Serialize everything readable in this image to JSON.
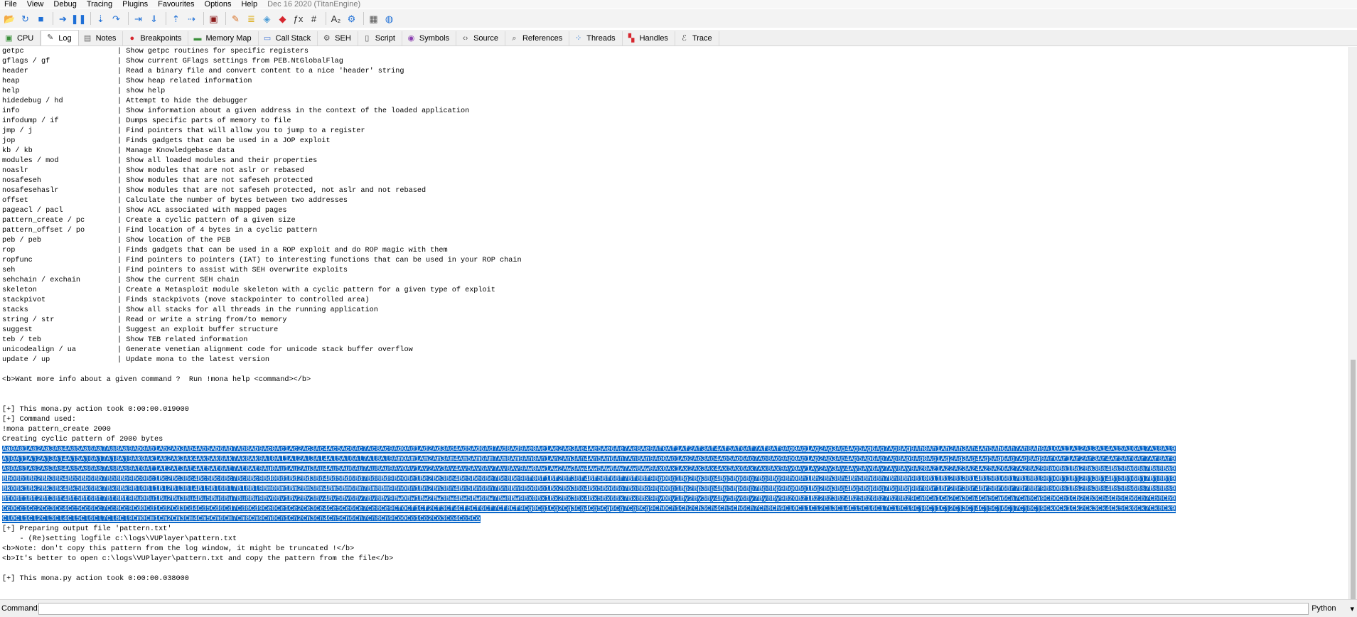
{
  "menubar": {
    "items": [
      "File",
      "View",
      "Debug",
      "Tracing",
      "Plugins",
      "Favourites",
      "Options",
      "Help"
    ],
    "build_info": "Dec 16 2020 (TitanEngine)"
  },
  "toolbar": {
    "buttons": [
      {
        "name": "open-icon",
        "glyph": "📂",
        "color": "#d9a400"
      },
      {
        "name": "restart-icon",
        "glyph": "↻",
        "color": "#1e6fd6"
      },
      {
        "name": "close-icon",
        "glyph": "■",
        "color": "#1e6fd6"
      },
      {
        "sep": true
      },
      {
        "name": "run-icon",
        "glyph": "➔",
        "color": "#1e6fd6"
      },
      {
        "name": "pause-icon",
        "glyph": "❚❚",
        "color": "#1e6fd6"
      },
      {
        "sep": true
      },
      {
        "name": "step-into-icon",
        "glyph": "⇣",
        "color": "#1e6fd6"
      },
      {
        "name": "step-over-icon",
        "glyph": "↷",
        "color": "#1e6fd6"
      },
      {
        "sep": true
      },
      {
        "name": "trace-into-icon",
        "glyph": "⇥",
        "color": "#1e6fd6"
      },
      {
        "name": "trace-over-icon",
        "glyph": "⇓",
        "color": "#1e6fd6"
      },
      {
        "sep": true
      },
      {
        "name": "execute-till-return-icon",
        "glyph": "⇡",
        "color": "#1e6fd6"
      },
      {
        "name": "run-to-user-code-icon",
        "glyph": "⇢",
        "color": "#1e6fd6"
      },
      {
        "sep": true
      },
      {
        "name": "scylla-icon",
        "glyph": "▣",
        "color": "#8b1a1a"
      },
      {
        "sep": true
      },
      {
        "name": "patch-icon",
        "glyph": "✎",
        "color": "#d9742a"
      },
      {
        "name": "script-icon",
        "glyph": "≣",
        "color": "#d9a400"
      },
      {
        "name": "comments-icon",
        "glyph": "◈",
        "color": "#4a9bd6"
      },
      {
        "name": "bookmark-icon",
        "glyph": "◆",
        "color": "#d6262e"
      },
      {
        "name": "function-icon",
        "glyph": "ƒx",
        "color": "#333333"
      },
      {
        "name": "hash-icon",
        "glyph": "#",
        "color": "#333333"
      },
      {
        "sep": true
      },
      {
        "name": "font-icon",
        "glyph": "A₂",
        "color": "#333333"
      },
      {
        "name": "settings-icon",
        "glyph": "⚙",
        "color": "#1e6fd6"
      },
      {
        "sep": true
      },
      {
        "name": "calculator-icon",
        "glyph": "▦",
        "color": "#555555"
      },
      {
        "name": "globe-icon",
        "glyph": "◍",
        "color": "#1e6fd6"
      }
    ]
  },
  "tabs": [
    {
      "key": "cpu",
      "label": "CPU",
      "icon": "cpu-icon",
      "glyph": "▣",
      "color": "#3a8f3a",
      "active": false
    },
    {
      "key": "log",
      "label": "Log",
      "icon": "log-icon",
      "glyph": "✎",
      "color": "#444444",
      "active": true
    },
    {
      "key": "notes",
      "label": "Notes",
      "icon": "notes-icon",
      "glyph": "▤",
      "color": "#666666",
      "active": false
    },
    {
      "key": "breakpoints",
      "label": "Breakpoints",
      "icon": "breakpoint-icon",
      "glyph": "●",
      "color": "#d6262e",
      "active": false
    },
    {
      "key": "memorymap",
      "label": "Memory Map",
      "icon": "memory-map-icon",
      "glyph": "▬",
      "color": "#3a8f3a",
      "active": false
    },
    {
      "key": "callstack",
      "label": "Call Stack",
      "icon": "call-stack-icon",
      "glyph": "▭",
      "color": "#4a7bd6",
      "active": false
    },
    {
      "key": "seh",
      "label": "SEH",
      "icon": "seh-icon",
      "glyph": "⚙",
      "color": "#555555",
      "active": false
    },
    {
      "key": "script",
      "label": "Script",
      "icon": "script-icon",
      "glyph": "▯",
      "color": "#555555",
      "active": false
    },
    {
      "key": "symbols",
      "label": "Symbols",
      "icon": "symbols-icon",
      "glyph": "◉",
      "color": "#8a3fb0",
      "active": false
    },
    {
      "key": "source",
      "label": "Source",
      "icon": "source-icon",
      "glyph": "‹›",
      "color": "#555555",
      "active": false
    },
    {
      "key": "references",
      "label": "References",
      "icon": "references-icon",
      "glyph": "⌕",
      "color": "#555555",
      "active": false
    },
    {
      "key": "threads",
      "label": "Threads",
      "icon": "threads-icon",
      "glyph": "⁘",
      "color": "#1e6fd6",
      "active": false
    },
    {
      "key": "handles",
      "label": "Handles",
      "icon": "handles-icon",
      "glyph": "▚",
      "color": "#d6262e",
      "active": false
    },
    {
      "key": "trace",
      "label": "Trace",
      "icon": "trace-icon",
      "glyph": "ℰ",
      "color": "#555555",
      "active": false
    }
  ],
  "log": {
    "commands": [
      {
        "cmd": "getpc",
        "desc": "| Show getpc routines for specific registers"
      },
      {
        "cmd": "gflags / gf",
        "desc": "| Show current GFlags settings from PEB.NtGlobalFlag"
      },
      {
        "cmd": "header",
        "desc": "| Read a binary file and convert content to a nice 'header' string"
      },
      {
        "cmd": "heap",
        "desc": "| Show heap related information"
      },
      {
        "cmd": "help",
        "desc": "| show help"
      },
      {
        "cmd": "hidedebug / hd",
        "desc": "| Attempt to hide the debugger"
      },
      {
        "cmd": "info",
        "desc": "| Show information about a given address in the context of the loaded application"
      },
      {
        "cmd": "infodump / if",
        "desc": "| Dumps specific parts of memory to file"
      },
      {
        "cmd": "jmp / j",
        "desc": "| Find pointers that will allow you to jump to a register"
      },
      {
        "cmd": "jop",
        "desc": "| Finds gadgets that can be used in a JOP exploit"
      },
      {
        "cmd": "kb / kb",
        "desc": "| Manage Knowledgebase data"
      },
      {
        "cmd": "modules / mod",
        "desc": "| Show all loaded modules and their properties"
      },
      {
        "cmd": "noaslr",
        "desc": "| Show modules that are not aslr or rebased"
      },
      {
        "cmd": "nosafeseh",
        "desc": "| Show modules that are not safeseh protected"
      },
      {
        "cmd": "nosafesehaslr",
        "desc": "| Show modules that are not safeseh protected, not aslr and not rebased"
      },
      {
        "cmd": "offset",
        "desc": "| Calculate the number of bytes between two addresses"
      },
      {
        "cmd": "pageacl / pacl",
        "desc": "| Show ACL associated with mapped pages"
      },
      {
        "cmd": "pattern_create / pc",
        "desc": "| Create a cyclic pattern of a given size"
      },
      {
        "cmd": "pattern_offset / po",
        "desc": "| Find location of 4 bytes in a cyclic pattern"
      },
      {
        "cmd": "peb / peb",
        "desc": "| Show location of the PEB"
      },
      {
        "cmd": "rop",
        "desc": "| Finds gadgets that can be used in a ROP exploit and do ROP magic with them"
      },
      {
        "cmd": "ropfunc",
        "desc": "| Find pointers to pointers (IAT) to interesting functions that can be used in your ROP chain"
      },
      {
        "cmd": "seh",
        "desc": "| Find pointers to assist with SEH overwrite exploits"
      },
      {
        "cmd": "sehchain / exchain",
        "desc": "| Show the current SEH chain"
      },
      {
        "cmd": "skeleton",
        "desc": "| Create a Metasploit module skeleton with a cyclic pattern for a given type of exploit"
      },
      {
        "cmd": "stackpivot",
        "desc": "| Finds stackpivots (move stackpointer to controlled area)"
      },
      {
        "cmd": "stacks",
        "desc": "| Show all stacks for all threads in the running application"
      },
      {
        "cmd": "string / str",
        "desc": "| Read or write a string from/to memory"
      },
      {
        "cmd": "suggest",
        "desc": "| Suggest an exploit buffer structure"
      },
      {
        "cmd": "teb / teb",
        "desc": "| Show TEB related information"
      },
      {
        "cmd": "unicodealign / ua",
        "desc": "| Generate venetian alignment code for unicode stack buffer overflow"
      },
      {
        "cmd": "update / up",
        "desc": "| Update mona to the latest version"
      }
    ],
    "lines_a": [
      "",
      "<b>Want more info about a given command ?  Run !mona help <command></b>",
      "",
      "",
      "[+] This mona.py action took 0:00:00.019000",
      "[+] Command used:",
      "!mona pattern_create 2000",
      "Creating cyclic pattern of 2000 bytes"
    ],
    "pattern_lines": [
      "Aa0Aa1Aa2Aa3Aa4Aa5Aa6Aa7Aa8Aa9Ab0Ab1Ab2Ab3Ab4Ab5Ab6Ab7Ab8Ab9Ac0Ac1Ac2Ac3Ac4Ac5Ac6Ac7Ac8Ac9Ad0Ad1Ad2Ad3Ad4Ad5Ad6Ad7Ad8Ad9Ae0Ae1Ae2Ae3Ae4Ae5Ae6Ae7Ae8Ae9Af0Af1Af2Af3Af4Af5Af6Af7Af8Af9Ag0Ag1Ag2Ag3Ag4Ag5Ag6Ag7Ag8Ag9Ah0Ah1Ah2Ah3Ah4Ah5Ah6Ah7Ah8Ah9Ai0Ai1Ai2Ai3Ai4Ai5Ai6Ai7Ai8Ai9",
      "Aj0Aj1Aj2Aj3Aj4Aj5Aj6Aj7Aj8Aj9Ak0Ak1Ak2Ak3Ak4Ak5Ak6Ak7Ak8Ak9Al0Al1Al2Al3Al4Al5Al6Al7Al8Al9Am0Am1Am2Am3Am4Am5Am6Am7Am8Am9An0An1An2An3An4An5An6An7An8An9Ao0Ao1Ao2Ao3Ao4Ao5Ao6Ao7Ao8Ao9Ap0Ap1Ap2Ap3Ap4Ap5Ap6Ap7Ap8Ap9Aq0Aq1Aq2Aq3Aq4Aq5Aq6Aq7Aq8Aq9Ar0Ar1Ar2Ar3Ar4Ar5Ar6Ar7Ar8Ar9",
      "As0As1As2As3As4As5As6As7As8As9At0At1At2At3At4At5At6At7At8At9Au0Au1Au2Au3Au4Au5Au6Au7Au8Au9Av0Av1Av2Av3Av4Av5Av6Av7Av8Av9Aw0Aw1Aw2Aw3Aw4Aw5Aw6Aw7Aw8Aw9Ax0Ax1Ax2Ax3Ax4Ax5Ax6Ax7Ax8Ax9Ay0Ay1Ay2Ay3Ay4Ay5Ay6Ay7Ay8Ay9Az0Az1Az2Az3Az4Az5Az6Az7Az8Az9Ba0Ba1Ba2Ba3Ba4Ba5Ba6Ba7Ba8Ba9",
      "Bb0Bb1Bb2Bb3Bb4Bb5Bb6Bb7Bb8Bb9Bc0Bc1Bc2Bc3Bc4Bc5Bc6Bc7Bc8Bc9Bd0Bd1Bd2Bd3Bd4Bd5Bd6Bd7Bd8Bd9Be0Be1Be2Be3Be4Be5Be6Be7Be8Be9Bf0Bf1Bf2Bf3Bf4Bf5Bf6Bf7Bf8Bf9Bg0Bg1Bg2Bg3Bg4Bg5Bg6Bg7Bg8Bg9Bh0Bh1Bh2Bh3Bh4Bh5Bh6Bh7Bh8Bh9Bi0Bi1Bi2Bi3Bi4Bi5Bi6Bi7Bi8Bi9Bj0Bj1Bj2Bj3Bj4Bj5Bj6Bj7Bj8Bj9",
      "Bk0Bk1Bk2Bk3Bk4Bk5Bk6Bk7Bk8Bk9Bl0Bl1Bl2Bl3Bl4Bl5Bl6Bl7Bl8Bl9Bm0Bm1Bm2Bm3Bm4Bm5Bm6Bm7Bm8Bm9Bn0Bn1Bn2Bn3Bn4Bn5Bn6Bn7Bn8Bn9Bo0Bo1Bo2Bo3Bo4Bo5Bo6Bo7Bo8Bo9Bp0Bp1Bp2Bp3Bp4Bp5Bp6Bp7Bp8Bp9Bq0Bq1Bq2Bq3Bq4Bq5Bq6Bq7Bq8Bq9Br0Br1Br2Br3Br4Br5Br6Br7Br8Br9Bs0Bs1Bs2Bs3Bs4Bs5Bs6Bs7Bs8Bs9",
      "Bt0Bt1Bt2Bt3Bt4Bt5Bt6Bt7Bt8Bt9Bu0Bu1Bu2Bu3Bu4Bu5Bu6Bu7Bu8Bu9Bv0Bv1Bv2Bv3Bv4Bv5Bv6Bv7Bv8Bv9Bw0Bw1Bw2Bw3Bw4Bw5Bw6Bw7Bw8Bw9Bx0Bx1Bx2Bx3Bx4Bx5Bx6Bx7Bx8Bx9By0By1By2By3By4By5By6By7By8By9Bz0Bz1Bz2Bz3Bz4Bz5Bz6Bz7Bz8Bz9Ca0Ca1Ca2Ca3Ca4Ca5Ca6Ca7Ca8Ca9Cb0Cb1Cb2Cb3Cb4Cb5Cb6Cb7Cb8Cb9",
      "Cc0Cc1Cc2Cc3Cc4Cc5Cc6Cc7Cc8Cc9Cd0Cd1Cd2Cd3Cd4Cd5Cd6Cd7Cd8Cd9Ce0Ce1Ce2Ce3Ce4Ce5Ce6Ce7Ce8Ce9Cf0Cf1Cf2Cf3Cf4Cf5Cf6Cf7Cf8Cf9Cg0Cg1Cg2Cg3Cg4Cg5Cg6Cg7Cg8Cg9Ch0Ch1Ch2Ch3Ch4Ch5Ch6Ch7Ch8Ch9Ci0Ci1Ci2Ci3Ci4Ci5Ci6Ci7Ci8Ci9Cj0Cj1Cj2Cj3Cj4Cj5Cj6Cj7Cj8Cj9Ck0Ck1Ck2Ck3Ck4Ck5Ck6Ck7Ck8Ck9",
      "Cl0Cl1Cl2Cl3Cl4Cl5Cl6Cl7Cl8Cl9Cm0Cm1Cm2Cm3Cm4Cm5Cm6Cm7Cm8Cm9Cn0Cn1Cn2Cn3Cn4Cn5Cn6Cn7Cn8Cn9Co0Co1Co2Co3Co4Co5Co"
    ],
    "lines_b": [
      "[+] Preparing output file 'pattern.txt'",
      "    - (Re)setting logfile c:\\logs\\VUPlayer\\pattern.txt",
      "<b>Note: don't copy this pattern from the log window, it might be truncated !</b>",
      "<b>It's better to open c:\\logs\\VUPlayer\\pattern.txt and copy the pattern from the file</b>",
      "",
      "[+] This mona.py action took 0:00:00.038000"
    ]
  },
  "command_bar": {
    "label": "Command:",
    "value": "",
    "language": "Python",
    "dropdown_glyph": "▾"
  },
  "colors": {
    "selection": "#0a67c9",
    "active_tab_bg": "#ffffff"
  }
}
